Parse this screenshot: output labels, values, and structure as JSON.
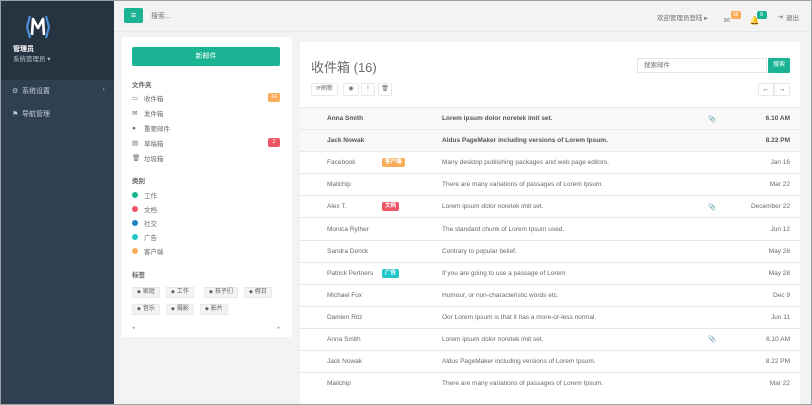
{
  "sidebar": {
    "profile_name": "管理员",
    "profile_role": "系统管理员 ▾",
    "items": [
      {
        "label": "系统设置",
        "icon": "gear-icon"
      },
      {
        "label": "导航管理",
        "icon": "flag-icon"
      }
    ]
  },
  "topbar": {
    "search_placeholder": "搜索...",
    "welcome": "欢迎管理员登陆 ▸",
    "mail_badge": "16",
    "bell_badge": "8",
    "logout": "退出"
  },
  "folders": {
    "compose_label": "新邮件",
    "folders_title": "文件夹",
    "items": [
      {
        "label": "收件箱",
        "icon": "inbox-icon",
        "badge": "16",
        "badge_color": "#f8ac59"
      },
      {
        "label": "发件箱",
        "icon": "envelope-icon",
        "badge": "",
        "badge_color": ""
      },
      {
        "label": "重要邮件",
        "icon": "certificate-icon",
        "badge": "",
        "badge_color": ""
      },
      {
        "label": "草稿箱",
        "icon": "file-icon",
        "badge": "2",
        "badge_color": "#ed5565"
      },
      {
        "label": "垃圾箱",
        "icon": "trash-icon",
        "badge": "",
        "badge_color": ""
      }
    ],
    "categories_title": "类别",
    "categories": [
      {
        "label": "工作",
        "color": "#1ab394"
      },
      {
        "label": "文档",
        "color": "#ed5565"
      },
      {
        "label": "社交",
        "color": "#1c84c6"
      },
      {
        "label": "广告",
        "color": "#23c6c8"
      },
      {
        "label": "客户端",
        "color": "#f8ac59"
      }
    ],
    "tags_title": "标签",
    "tags": [
      "家庭",
      "工作",
      "孩子们",
      "假日",
      "音乐",
      "摄影",
      "影片"
    ]
  },
  "mailbox": {
    "title": "收件箱 (16)",
    "search_placeholder": "搜索邮件",
    "search_button": "搜索",
    "refresh_label": "刷新",
    "rows": [
      {
        "sender": "Anna Smith",
        "label": "",
        "label_color": "",
        "subject": "Lorem ipsum dolor noretek imit set.",
        "attach": true,
        "date": "6.10 AM",
        "unread": true
      },
      {
        "sender": "Jack Nowak",
        "label": "",
        "label_color": "",
        "subject": "Aldus PageMaker including versions of Lorem Ipsum.",
        "attach": false,
        "date": "8.22 PM",
        "unread": true
      },
      {
        "sender": "Facebook",
        "label": "客户端",
        "label_color": "#f8ac59",
        "subject": "Many desktop publishing packages and web page editors.",
        "attach": false,
        "date": "Jan 16",
        "unread": false
      },
      {
        "sender": "Mailchip",
        "label": "",
        "label_color": "",
        "subject": "There are many variations of passages of Lorem Ipsum.",
        "attach": false,
        "date": "Mar 22",
        "unread": false
      },
      {
        "sender": "Alex T.",
        "label": "文档",
        "label_color": "#ed5565",
        "subject": "Lorem ipsum dolor noretek imit set.",
        "attach": true,
        "date": "December 22",
        "unread": false
      },
      {
        "sender": "Monica Ryther",
        "label": "",
        "label_color": "",
        "subject": "The standard chunk of Lorem Ipsum used.",
        "attach": false,
        "date": "Jun 12",
        "unread": false
      },
      {
        "sender": "Sandra Derick",
        "label": "",
        "label_color": "",
        "subject": "Contrary to popular belief.",
        "attach": false,
        "date": "May 28",
        "unread": false
      },
      {
        "sender": "Patrick Pertners",
        "label": "广告",
        "label_color": "#23c6c8",
        "subject": "If you are going to use a passage of Lorem",
        "attach": false,
        "date": "May 28",
        "unread": false
      },
      {
        "sender": "Michael Fox",
        "label": "",
        "label_color": "",
        "subject": "Humour, or non-characteristic words etc.",
        "attach": false,
        "date": "Dec 9",
        "unread": false
      },
      {
        "sender": "Damien Ritz",
        "label": "",
        "label_color": "",
        "subject": "Oor Lorem Ipsum is that it has a more-or-less normal.",
        "attach": false,
        "date": "Jun 11",
        "unread": false
      },
      {
        "sender": "Anna Smith",
        "label": "",
        "label_color": "",
        "subject": "Lorem ipsum dolor noretek imit set.",
        "attach": true,
        "date": "6.10 AM",
        "unread": false
      },
      {
        "sender": "Jack Nowak",
        "label": "",
        "label_color": "",
        "subject": "Aldus PageMaker including versions of Lorem Ipsum.",
        "attach": false,
        "date": "8.22 PM",
        "unread": false
      },
      {
        "sender": "Mailchip",
        "label": "",
        "label_color": "",
        "subject": "There are many variations of passages of Lorem Ipsum.",
        "attach": false,
        "date": "Mar 22",
        "unread": false
      }
    ]
  },
  "colors": {
    "accent": "#1ab394",
    "sidebar": "#2f4050"
  }
}
